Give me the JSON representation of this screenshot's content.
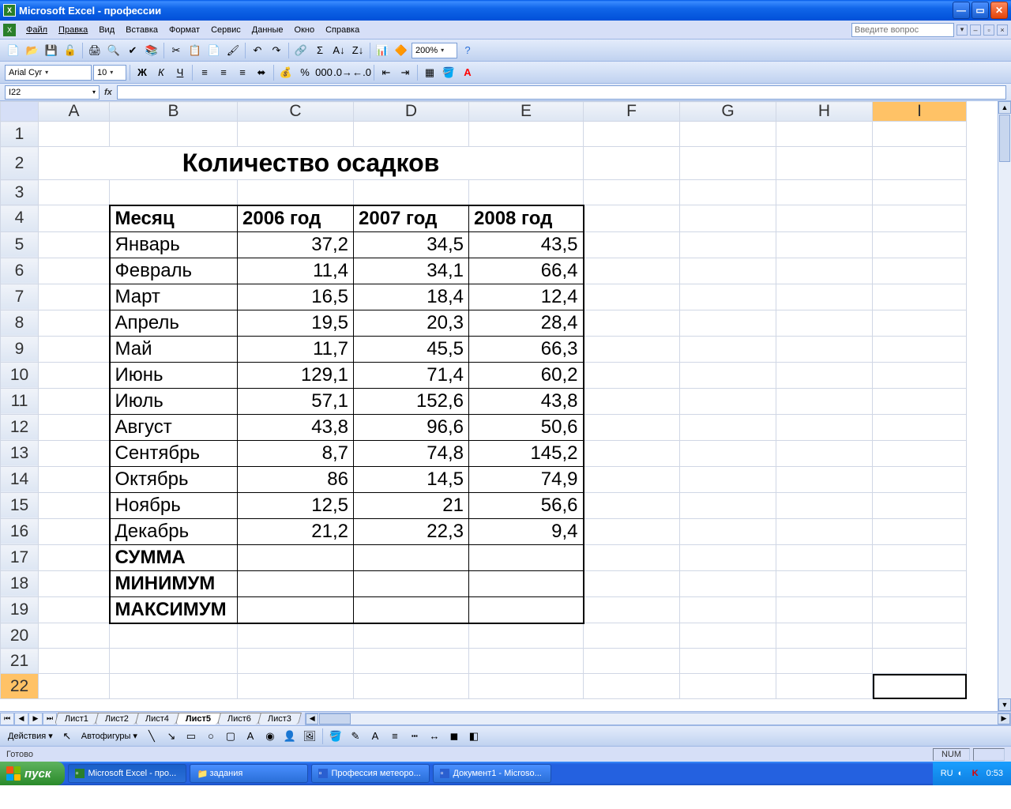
{
  "titlebar": {
    "title": "Microsoft Excel - профессии"
  },
  "menu": {
    "file": "Файл",
    "edit": "Правка",
    "view": "Вид",
    "insert": "Вставка",
    "format": "Формат",
    "service": "Сервис",
    "data": "Данные",
    "window": "Окно",
    "help": "Справка",
    "helpbox_placeholder": "Введите вопрос"
  },
  "toolbar": {
    "zoom": "200%"
  },
  "formatbar": {
    "font": "Arial Cyr",
    "size": "10"
  },
  "formula": {
    "cellref": "I22"
  },
  "columns": [
    "A",
    "B",
    "C",
    "D",
    "E",
    "F",
    "G",
    "H",
    "I"
  ],
  "row_numbers": [
    1,
    2,
    3,
    4,
    5,
    6,
    7,
    8,
    9,
    10,
    11,
    12,
    13,
    14,
    15,
    16,
    17,
    18,
    19,
    20,
    21,
    22
  ],
  "sheet": {
    "title": "Количество осадков",
    "headers": {
      "month": "Месяц",
      "y2006": "2006 год",
      "y2007": "2007 год",
      "y2008": "2008 год"
    },
    "rows": [
      {
        "m": "Январь",
        "a": "37,2",
        "b": "34,5",
        "c": "43,5"
      },
      {
        "m": "Февраль",
        "a": "11,4",
        "b": "34,1",
        "c": "66,4"
      },
      {
        "m": "Март",
        "a": "16,5",
        "b": "18,4",
        "c": "12,4"
      },
      {
        "m": "Апрель",
        "a": "19,5",
        "b": "20,3",
        "c": "28,4"
      },
      {
        "m": "Май",
        "a": "11,7",
        "b": "45,5",
        "c": "66,3"
      },
      {
        "m": "Июнь",
        "a": "129,1",
        "b": "71,4",
        "c": "60,2"
      },
      {
        "m": "Июль",
        "a": "57,1",
        "b": "152,6",
        "c": "43,8"
      },
      {
        "m": "Август",
        "a": "43,8",
        "b": "96,6",
        "c": "50,6"
      },
      {
        "m": "Сентябрь",
        "a": "8,7",
        "b": "74,8",
        "c": "145,2"
      },
      {
        "m": "Октябрь",
        "a": "86",
        "b": "14,5",
        "c": "74,9"
      },
      {
        "m": "Ноябрь",
        "a": "12,5",
        "b": "21",
        "c": "56,6"
      },
      {
        "m": "Декабрь",
        "a": "21,2",
        "b": "22,3",
        "c": "9,4"
      }
    ],
    "sum": "СУММА",
    "min": "МИНИМУМ",
    "max": "МАКСИМУМ"
  },
  "tabs": [
    "Лист1",
    "Лист2",
    "Лист4",
    "Лист5",
    "Лист6",
    "Лист3"
  ],
  "tabs_active": 3,
  "drawbar": {
    "actions": "Действия",
    "autoshapes": "Автофигуры"
  },
  "status": {
    "ready": "Готово",
    "num": "NUM"
  },
  "taskbar": {
    "start": "пуск",
    "tasks": [
      {
        "icon": "excel",
        "label": "Microsoft Excel - про..."
      },
      {
        "icon": "folder",
        "label": "задания"
      },
      {
        "icon": "word",
        "label": "Профессия метеоро..."
      },
      {
        "icon": "word",
        "label": "Документ1 - Microso..."
      }
    ],
    "lang": "RU",
    "clock": "0:53"
  }
}
